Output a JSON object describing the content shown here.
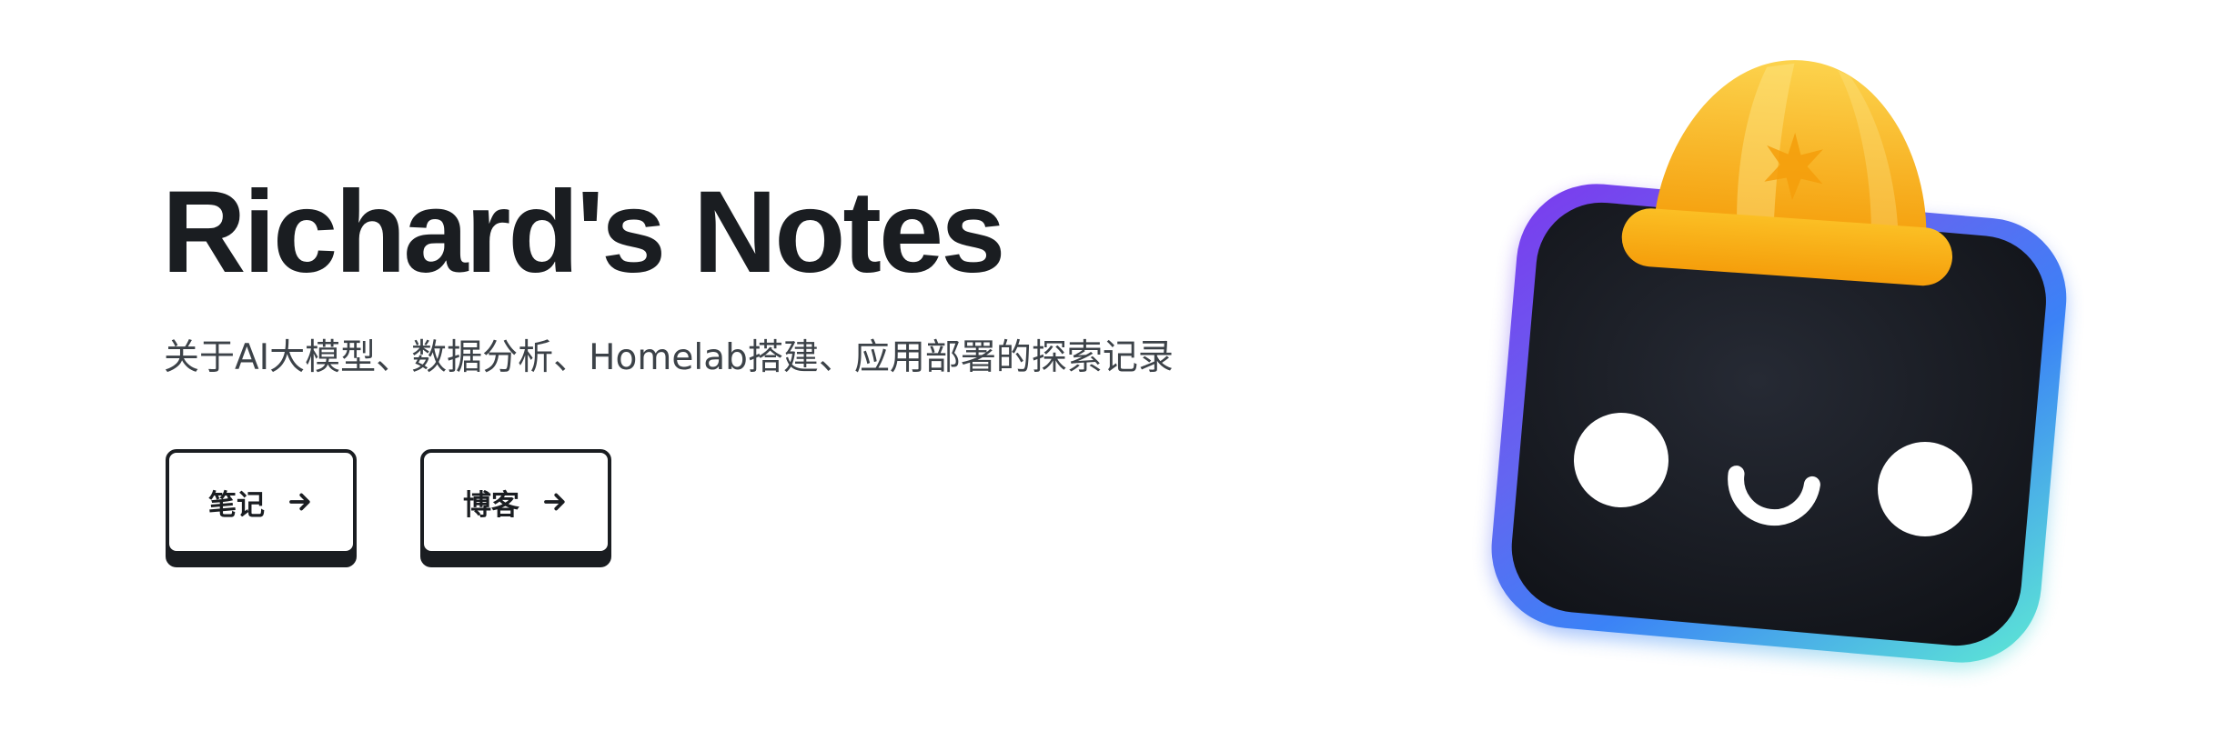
{
  "hero": {
    "title": "Richard's Notes",
    "subtitle": "关于AI大模型、数据分析、Homelab搭建、应用部署的探索记录"
  },
  "buttons": [
    {
      "label": "笔记",
      "icon": "arrow-right-icon"
    },
    {
      "label": "博客",
      "icon": "arrow-right-icon"
    }
  ],
  "mascot": {
    "icon": "robot-mascot-with-hard-hat",
    "colors": {
      "screen": "#14161c",
      "frame_gradient": [
        "#8b5cf6",
        "#3b82f6",
        "#5eead4"
      ],
      "helmet": "#fbb034",
      "eyes": "#ffffff"
    }
  },
  "colors": {
    "text": "#1a1d21",
    "subtitle": "#3c4248",
    "background": "#ffffff"
  }
}
